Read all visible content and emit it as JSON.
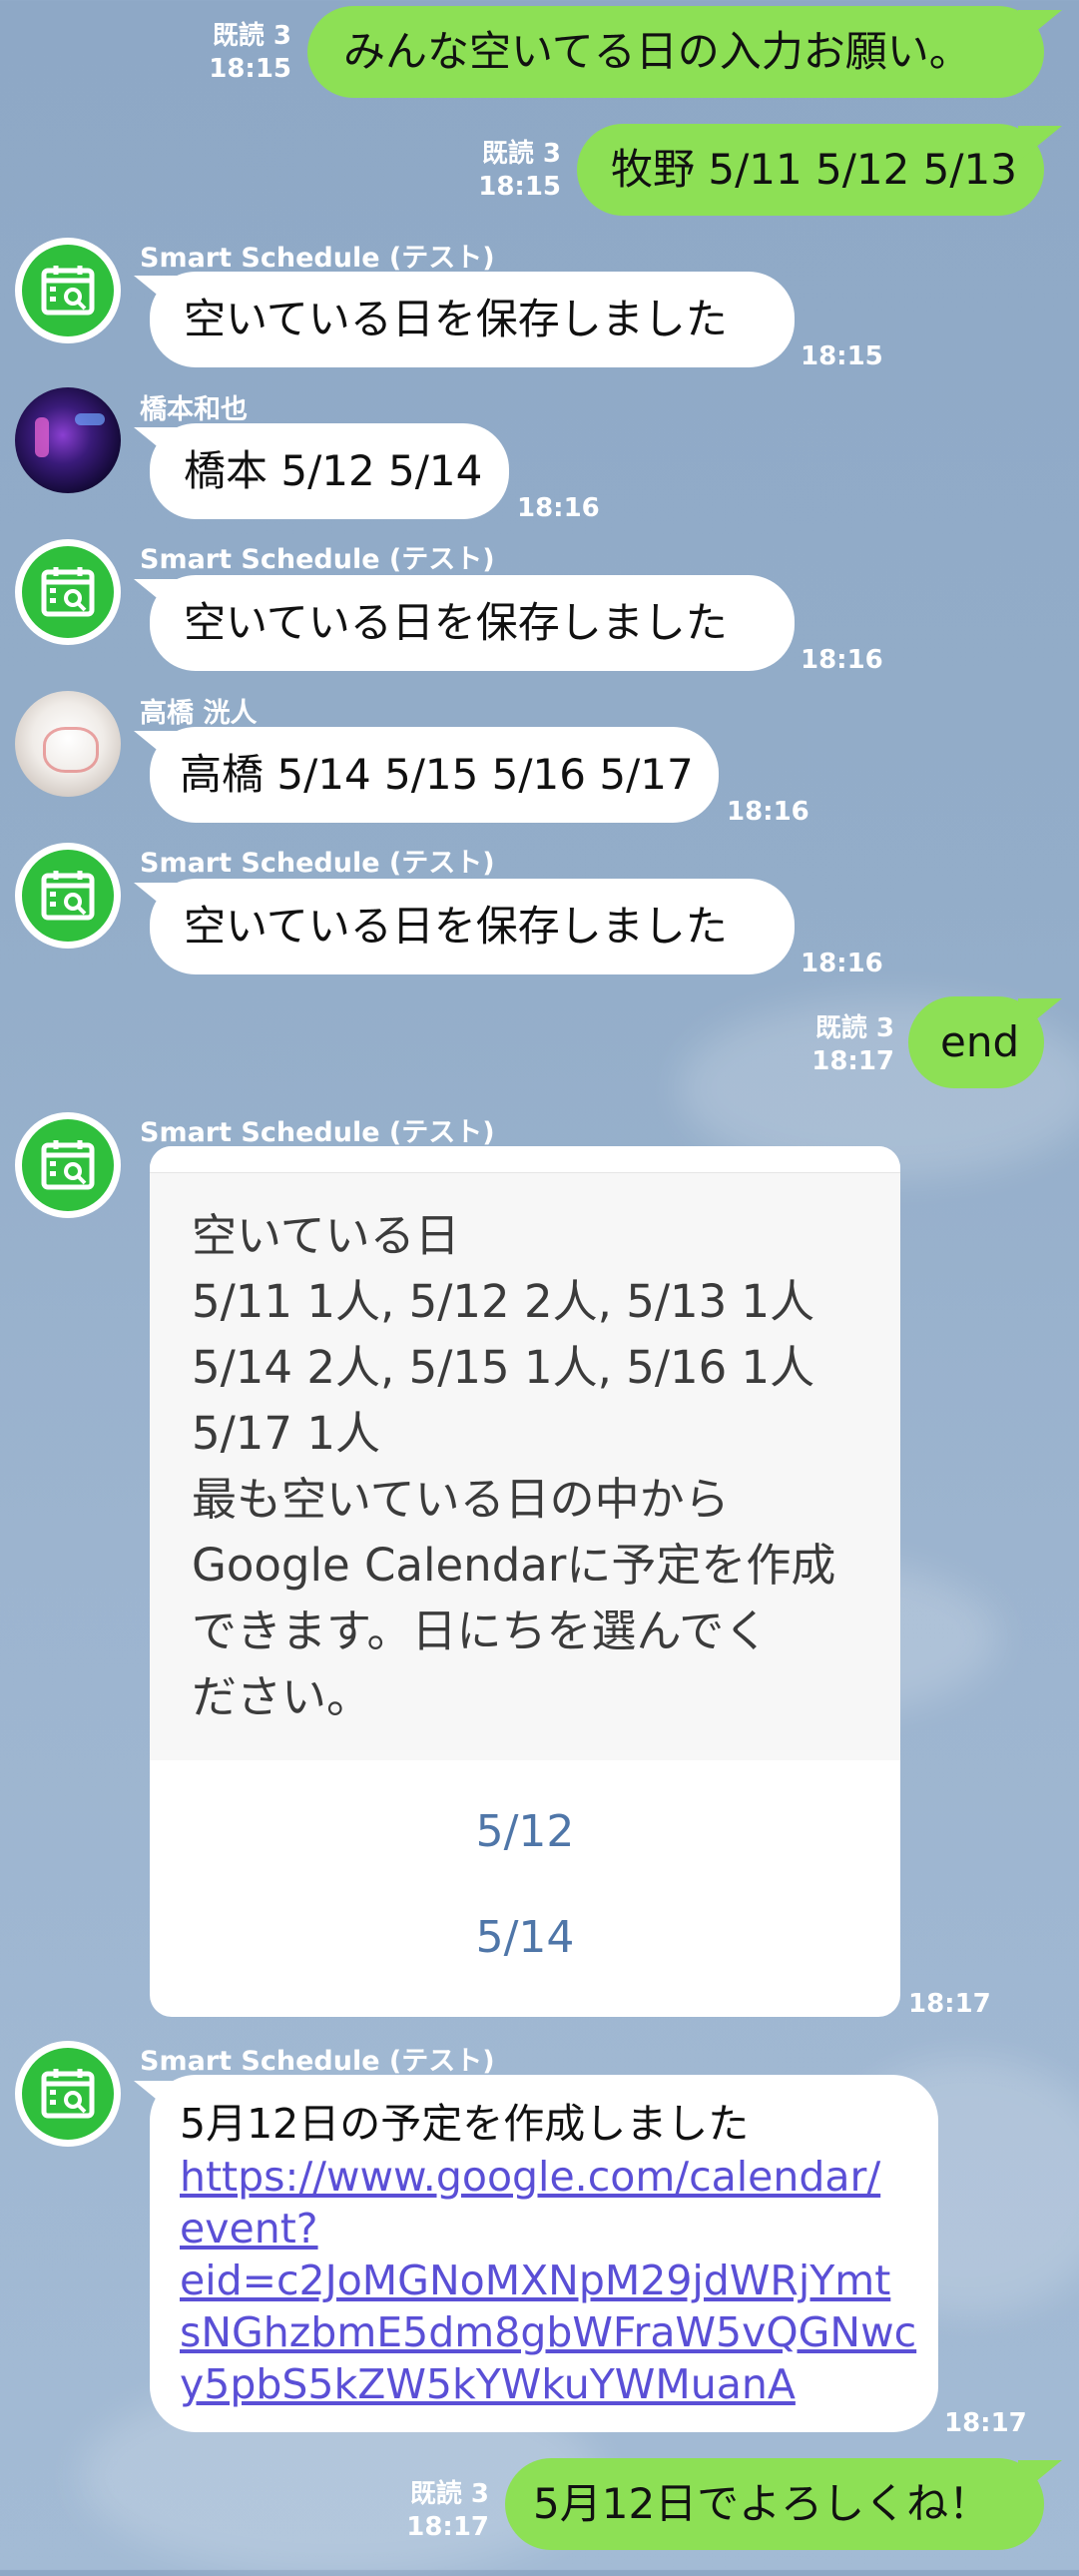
{
  "read_label": "既読 3",
  "bot_name": "Smart Schedule (テスト)",
  "messages": {
    "m1": {
      "text": "みんな空いてる日の入力お願い。",
      "time": "18:15"
    },
    "m2": {
      "text": "牧野 5/11 5/12 5/13",
      "time": "18:15"
    },
    "m3": {
      "text": "空いている日を保存しました",
      "time": "18:15"
    },
    "m4": {
      "sender": "橋本和也",
      "text": "橋本 5/12 5/14",
      "time": "18:16"
    },
    "m5": {
      "text": "空いている日を保存しました",
      "time": "18:16"
    },
    "m6": {
      "sender": "高橋 洸人",
      "text": "高橋 5/14 5/15 5/16 5/17",
      "time": "18:16"
    },
    "m7": {
      "text": "空いている日を保存しました",
      "time": "18:16"
    },
    "m8": {
      "text": "end",
      "time": "18:17"
    },
    "m9": {
      "time": "18:17",
      "lines": [
        "空いている日",
        "5/11 1人, 5/12 2人, 5/13 1人",
        "5/14 2人, 5/15 1人, 5/16 1人",
        "5/17 1人",
        "最も空いている日の中から",
        "Google Calendarに予定を作成",
        "できます。日にちを選んでく",
        "ださい。"
      ],
      "actions": [
        "5/12",
        "5/14"
      ]
    },
    "m10": {
      "time": "18:17",
      "title": "5月12日の予定を作成しました",
      "link_lines": [
        "https://www.google.com/calendar/",
        "event?",
        "eid=c2JoMGNoMXNpM29jdWRjYmt",
        "sNGhzbmE5dm8gbWFraW5vQGNwc",
        "y5pbS5kZW5kYWkuYWMuanA"
      ]
    },
    "m11": {
      "text": "5月12日でよろしくね！",
      "time": "18:17"
    }
  }
}
